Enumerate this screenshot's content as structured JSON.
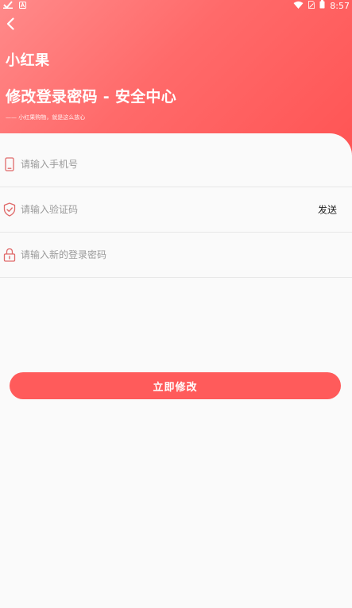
{
  "status_bar": {
    "time": "8:57"
  },
  "header": {
    "app_name": "小红果",
    "page_title": "修改登录密码 - 安全中心",
    "slogan": "—— 小红果购物，就是这么放心"
  },
  "form": {
    "phone_placeholder": "请输入手机号",
    "code_placeholder": "请输入验证码",
    "send_label": "发送",
    "password_placeholder": "请输入新的登录密码"
  },
  "actions": {
    "submit_label": "立即修改"
  },
  "colors": {
    "accent": "#ff5b5b",
    "header_start": "#ff8a8a",
    "header_end": "#ff5454",
    "icon": "#e06a6a"
  },
  "icons": {
    "back": "chevron-left-icon",
    "phone": "phone-icon",
    "code": "shield-check-icon",
    "password": "lock-icon"
  }
}
